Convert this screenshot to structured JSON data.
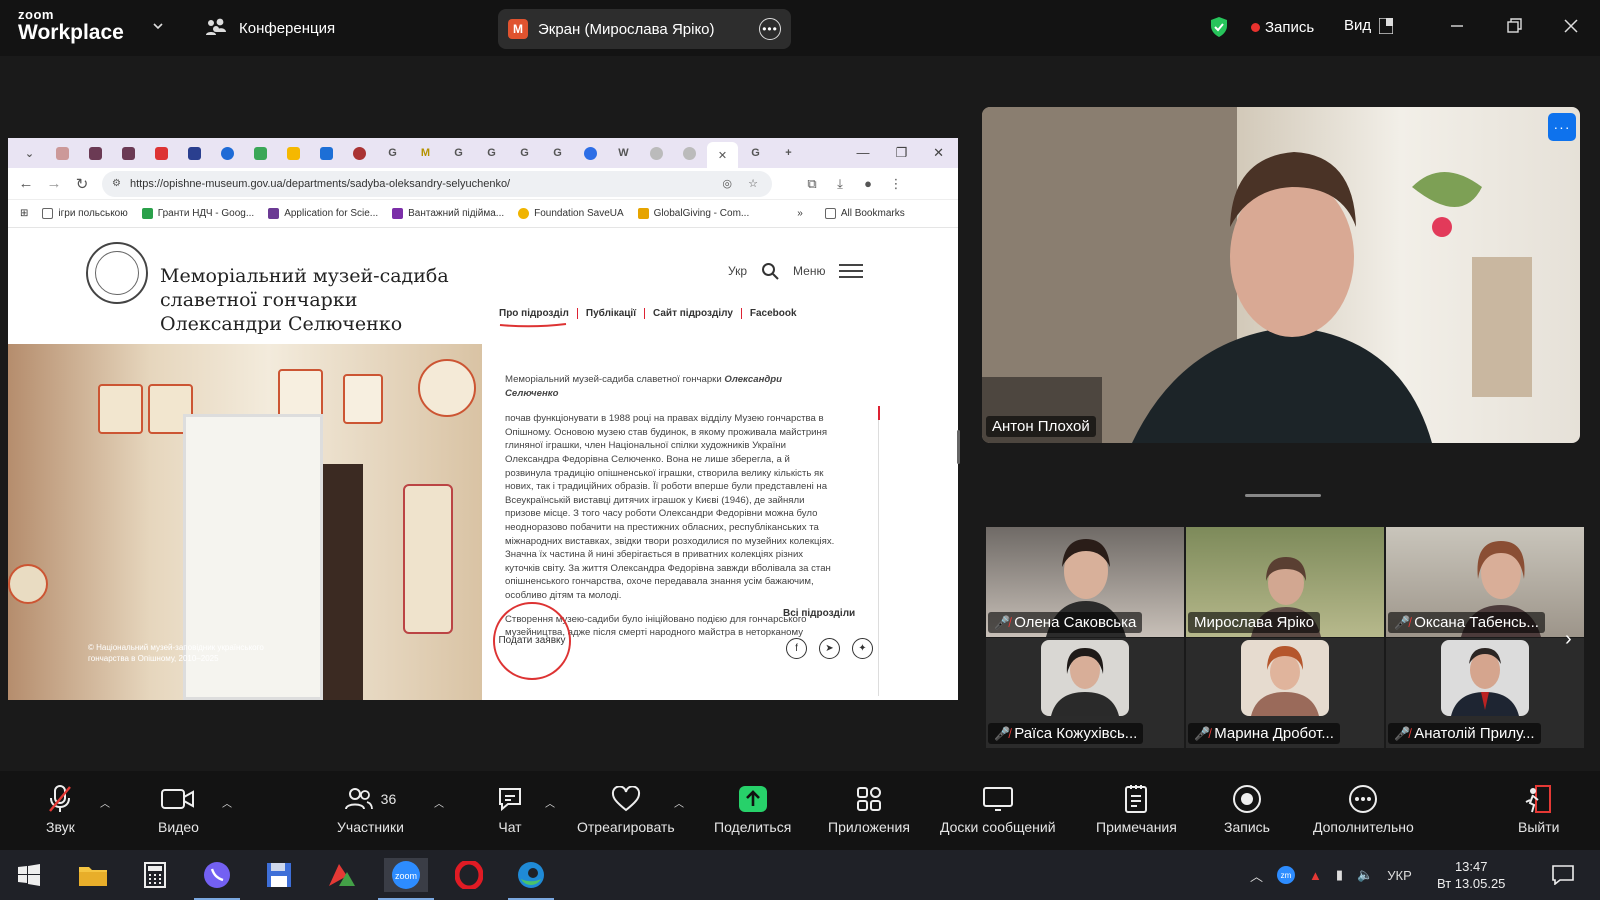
{
  "app": {
    "brand_top": "zoom",
    "brand_bottom": "Workplace",
    "meeting_label": "Конференция",
    "share_initial": "M",
    "share_label": "Экран (Мирослава Ярiко)",
    "record_label": "Запись",
    "view_label": "Вид"
  },
  "browser": {
    "url": "https://opishne-museum.gov.ua/departments/sadyba-oleksandry-selyuchenko/",
    "tabs": [
      "",
      "",
      "",
      "",
      "",
      "",
      "",
      "",
      "",
      "",
      "",
      "G",
      "M",
      "G",
      "G",
      "G",
      "G",
      "",
      "W",
      "",
      "",
      "",
      "G"
    ],
    "bookmarks": [
      "ігри польською",
      "Гранти НДЧ - Goog...",
      "Application for Scie...",
      "Вантажний підійма...",
      "Foundation SaveUA",
      "GlobalGiving - Com..."
    ],
    "all_bookmarks": "All Bookmarks",
    "site": {
      "title_l1": "Меморіальний музей-садиба",
      "title_l2": "славетної гончарки",
      "title_l3": "Олександри Селюченко",
      "lang": "Укр",
      "menu": "Меню",
      "subnav": [
        "Про підрозділ",
        "Публікації",
        "Сайт підрозділу",
        "Facebook"
      ],
      "intro_plain": "Меморіальний музей-садиба славетної гончарки ",
      "intro_bold": "Олександри Селюченко",
      "body": "почав функціонувати в   1988 році на правах відділу Музею гончарства в Опішному. Основою музею став будинок, в якому проживала майстриня глиняної іграшки, член Національної спілки художників України Олександра Федорівна Селюченко. Вона не лише зберегла, а й розвинула традицію опішненської іграшки, створила велику кількість як нових, так і традиційних образів. Її роботи вперше були представлені на Всеукраїнській виставці дитячих іграшок у Києві (1946), де зайняли призове місце. З того часу роботи Олександри Федорівни можна було неодноразово побачити на престижних обласних, республіканських та міжнародних виставках, звідки твори розходилися по музейних колекціях. Значна їх частина й нині зберігається в приватних колекціях різних куточків світу. За життя Олександра Федорівна завжди вболівала за стан опішненського гончарства, охоче передавала знання усім бажаючим, особливо дітям та молоді.",
      "body2": "Створення музею-садиби було ініційовано подією для гончарського музейництва, адже після смерті народного майстра в неторканому вигляді було збережено двориськ",
      "photo_caption": "© Національний музей-заповідник українського гончарства в Опішному, 2010–2025",
      "apply_label": "Подати заявку",
      "all_sections": "Всі підрозділи",
      "social": [
        "f",
        "tg",
        "tw"
      ]
    }
  },
  "participants": {
    "active_speaker": "Антон Плохой",
    "tiles": [
      {
        "name": "Олена Саковська",
        "muted": true
      },
      {
        "name": "Мирослава Ярiко",
        "muted": false
      },
      {
        "name": "Оксана Табенсь...",
        "muted": true
      },
      {
        "name": "Раїса Кожухівсь...",
        "muted": true
      },
      {
        "name": "Марина Дробот...",
        "muted": true
      },
      {
        "name": "Анатолій Прилу...",
        "muted": true
      }
    ]
  },
  "toolbar": {
    "audio": "Звук",
    "video": "Видео",
    "participants": "Участники",
    "participants_count": "36",
    "chat": "Чат",
    "react": "Отреагировать",
    "share": "Поделиться",
    "apps": "Приложения",
    "whiteboards": "Доски сообщений",
    "notes": "Примечания",
    "record": "Запись",
    "more": "Дополнительно",
    "leave": "Выйти"
  },
  "taskbar": {
    "lang": "УКР",
    "time": "13:47",
    "date": "Вт 13.05.25"
  },
  "colors": {
    "accent_blue": "#0e72ed",
    "record_red": "#e8322e",
    "share_green": "#27d16a",
    "mic_off_red": "#e53935"
  }
}
